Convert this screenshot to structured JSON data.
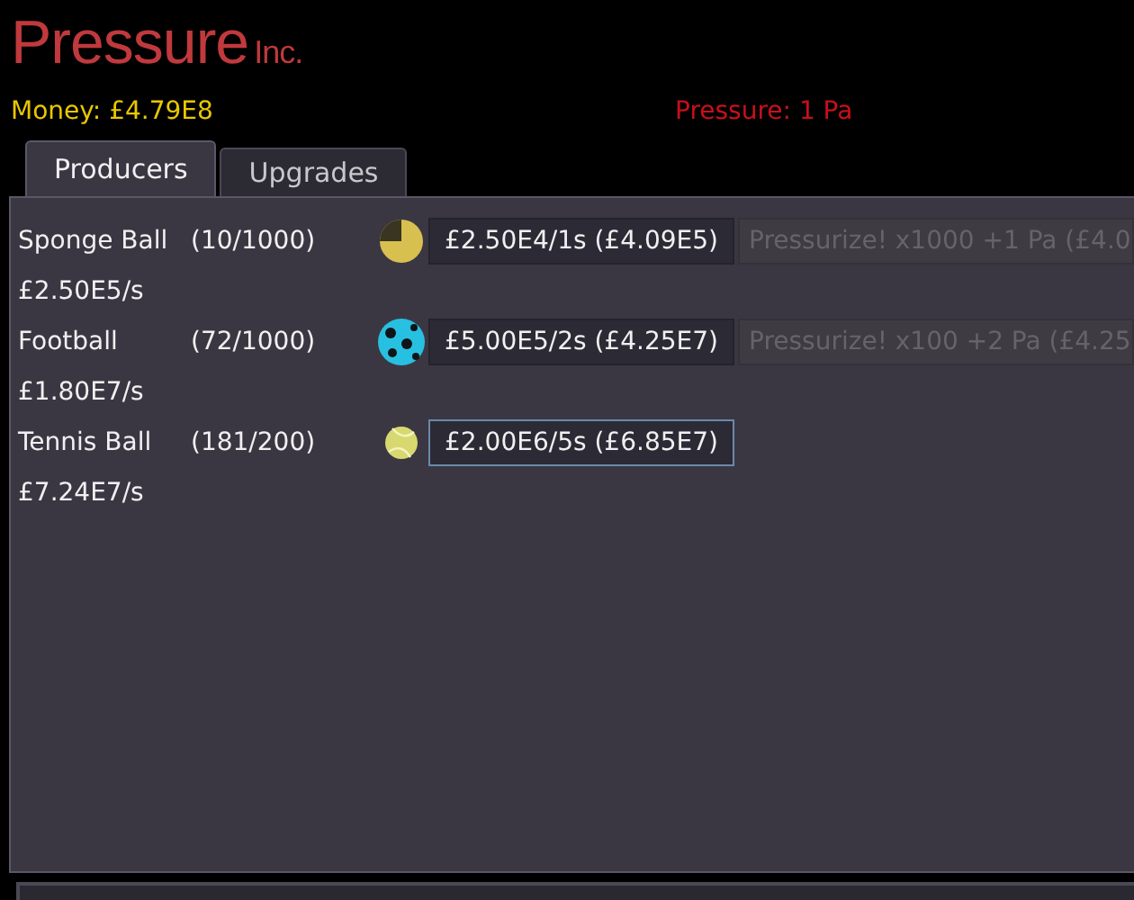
{
  "header": {
    "title": "Pressure",
    "title_suffix": "Inc.",
    "money": "Money: £4.79E8",
    "pressure": "Pressure: 1 Pa"
  },
  "tabs": [
    {
      "label": "Producers",
      "selected": true
    },
    {
      "label": "Upgrades",
      "selected": false
    }
  ],
  "producers": [
    {
      "kind": "sponge",
      "name": "Sponge Ball",
      "count": "(10/1000)",
      "rate": "£2.50E5/s",
      "buy": {
        "label": "£2.50E4/1s (£4.09E5)",
        "focused": false
      },
      "pressurize": {
        "label": "Pressurize! x1000 +1 Pa (£4.0",
        "disabled": true
      }
    },
    {
      "kind": "football",
      "name": "Football",
      "count": "(72/1000)",
      "rate": "£1.80E7/s",
      "buy": {
        "label": "£5.00E5/2s (£4.25E7)",
        "focused": false
      },
      "pressurize": {
        "label": "Pressurize! x100 +2 Pa (£4.25",
        "disabled": true
      }
    },
    {
      "kind": "tennis",
      "name": "Tennis Ball",
      "count": "(181/200)",
      "rate": "£7.24E7/s",
      "buy": {
        "label": "£2.00E6/5s (£6.85E7)",
        "focused": true
      }
    }
  ]
}
